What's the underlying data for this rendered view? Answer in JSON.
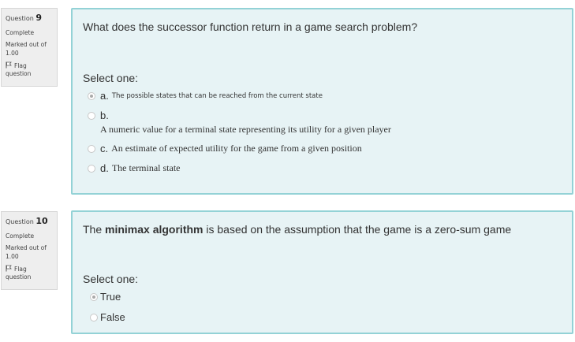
{
  "questions": [
    {
      "number_label": "Question",
      "number": "9",
      "state": "Complete",
      "marked": "Marked out of",
      "max": "1.00",
      "flag_label": "Flag question",
      "text": "What does the successor function return in a game search problem?",
      "prompt": "Select one:",
      "options": [
        {
          "letter": "a.",
          "text": "The possible states that can be reached from the current state",
          "selected": true
        },
        {
          "letter": "b.",
          "text": "A numeric value for a terminal state representing its utility for a given player",
          "selected": false
        },
        {
          "letter": "c.",
          "text": "An estimate of expected utility for the game from a given position",
          "selected": false
        },
        {
          "letter": "d.",
          "text": "The terminal state",
          "selected": false
        }
      ]
    },
    {
      "number_label": "Question",
      "number": "10",
      "state": "Complete",
      "marked": "Marked out of",
      "max": "1.00",
      "flag_label": "Flag question",
      "text_before": "The ",
      "text_bold": "minimax algorithm",
      "text_after": " is based on the assumption that the game is a zero-sum game",
      "prompt": "Select one:",
      "options": [
        {
          "text": "True",
          "selected": true
        },
        {
          "text": "False",
          "selected": false
        }
      ]
    }
  ],
  "colors": {
    "card_bg": "#e7f3f5",
    "card_border": "#93d2d6",
    "info_bg": "#eeeeee"
  },
  "icons": {
    "flag": "flag-icon",
    "radio": "radio-icon"
  }
}
